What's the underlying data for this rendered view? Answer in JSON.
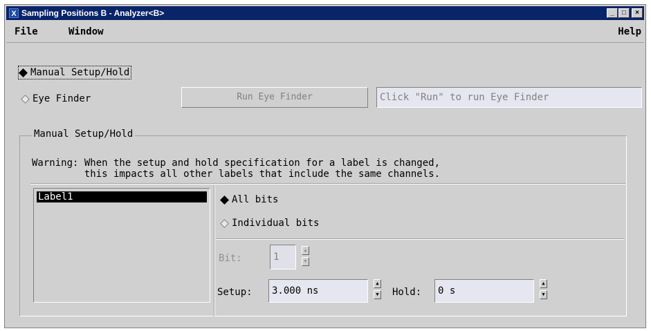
{
  "window": {
    "title": "Sampling Positions B - Analyzer<B>",
    "app_icon": "X",
    "controls": [
      "minimize",
      "maximize",
      "close"
    ]
  },
  "menubar": {
    "file": "File",
    "window": "Window",
    "help": "Help"
  },
  "mode": {
    "manual_label": "Manual Setup/Hold",
    "manual_selected": true,
    "eye_finder_label": "Eye Finder",
    "eye_finder_selected": false,
    "run_button": "Run Eye Finder",
    "status_text": "Click \"Run\" to run Eye Finder"
  },
  "manual_group": {
    "title": "Manual Setup/Hold",
    "warning_line1": "Warning: When the setup and hold specification for a label is changed,",
    "warning_line2": "         this impacts all other labels that include the same channels.",
    "labels": [
      "Label1"
    ],
    "selected_label": "Label1",
    "all_bits_label": "All bits",
    "all_bits_selected": true,
    "individual_bits_label": "Individual bits",
    "individual_bits_selected": false,
    "bit_label": "Bit:",
    "bit_value": "1",
    "setup_label": "Setup:",
    "setup_value": "3.000 ns",
    "hold_label": "Hold:",
    "hold_value": "0 s"
  }
}
